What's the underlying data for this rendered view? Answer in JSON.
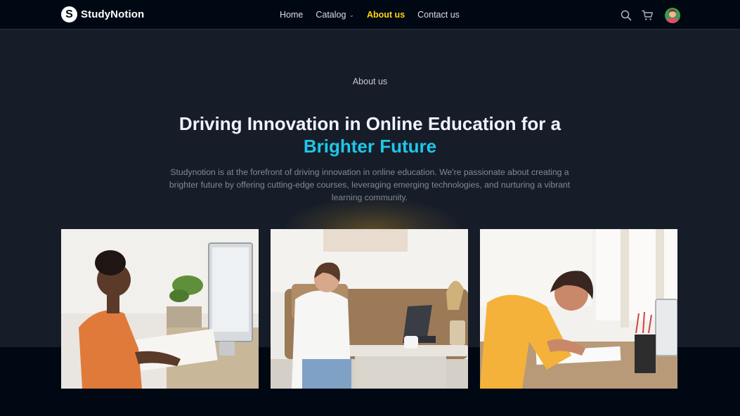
{
  "brand": {
    "logo_letter": "S",
    "name": "StudyNotion"
  },
  "nav": {
    "links": [
      {
        "label": "Home"
      },
      {
        "label": "Catalog"
      },
      {
        "label": "About us"
      },
      {
        "label": "Contact us"
      }
    ],
    "active": "About us"
  },
  "icons": [
    "search-icon",
    "cart-icon",
    "avatar"
  ],
  "hero": {
    "eyebrow": "About us",
    "heading_line1": "Driving Innovation in Online Education for a",
    "heading_line2": "Brighter Future",
    "paragraph": "Studynotion is at the forefront of driving innovation in online education. We're passionate about creating a brighter future by offering cutting-edge courses, leveraging emerging technologies, and nurturing a vibrant learning community."
  },
  "colors": {
    "accent_yellow": "#FFD60A",
    "highlight_blue": "#1FC6E8",
    "hero_bg": "#161D29",
    "page_bg": "#000814"
  }
}
